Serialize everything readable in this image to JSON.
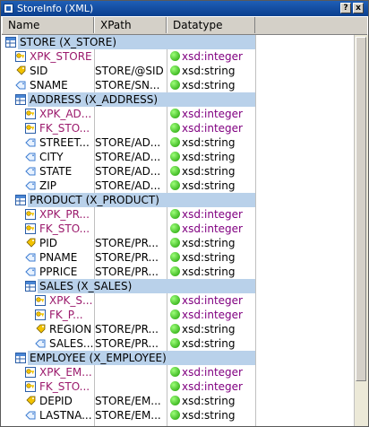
{
  "window": {
    "title": "StoreInfo (XML)",
    "help_label": "?",
    "close_label": "x"
  },
  "columns": {
    "name": "Name",
    "xpath": "XPath",
    "datatype": "Datatype"
  },
  "rows": [
    {
      "level": 0,
      "kind": "table",
      "name": "STORE     (X_STORE)",
      "xpath": "",
      "type": ""
    },
    {
      "level": 1,
      "kind": "key-pk",
      "name": "XPK_STORE",
      "xpath": "",
      "type": "xsd:integer",
      "red": true
    },
    {
      "level": 1,
      "kind": "key",
      "name": "SID",
      "xpath": "STORE/@SID",
      "type": "xsd:string"
    },
    {
      "level": 1,
      "kind": "attr",
      "name": "SNAME",
      "xpath": "STORE/SN...",
      "type": "xsd:string"
    },
    {
      "level": 1,
      "kind": "table",
      "name": "ADDRESS     (X_ADDRESS)",
      "xpath": "",
      "type": ""
    },
    {
      "level": 2,
      "kind": "key-pk",
      "name": "XPK_AD...",
      "xpath": "",
      "type": "xsd:integer",
      "red": true
    },
    {
      "level": 2,
      "kind": "key-fk",
      "name": "FK_STO...",
      "xpath": "",
      "type": "xsd:integer",
      "red": true
    },
    {
      "level": 2,
      "kind": "attr",
      "name": "STREET...",
      "xpath": "STORE/AD...",
      "type": "xsd:string"
    },
    {
      "level": 2,
      "kind": "attr",
      "name": "CITY",
      "xpath": "STORE/AD...",
      "type": "xsd:string"
    },
    {
      "level": 2,
      "kind": "attr",
      "name": "STATE",
      "xpath": "STORE/AD...",
      "type": "xsd:string"
    },
    {
      "level": 2,
      "kind": "attr",
      "name": "ZIP",
      "xpath": "STORE/AD...",
      "type": "xsd:string"
    },
    {
      "level": 1,
      "kind": "table",
      "name": "PRODUCT     (X_PRODUCT)",
      "xpath": "",
      "type": ""
    },
    {
      "level": 2,
      "kind": "key-pk",
      "name": "XPK_PR...",
      "xpath": "",
      "type": "xsd:integer",
      "red": true
    },
    {
      "level": 2,
      "kind": "key-fk",
      "name": "FK_STO...",
      "xpath": "",
      "type": "xsd:integer",
      "red": true
    },
    {
      "level": 2,
      "kind": "key",
      "name": "PID",
      "xpath": "STORE/PR...",
      "type": "xsd:string"
    },
    {
      "level": 2,
      "kind": "attr",
      "name": "PNAME",
      "xpath": "STORE/PR...",
      "type": "xsd:string"
    },
    {
      "level": 2,
      "kind": "attr",
      "name": "PPRICE",
      "xpath": "STORE/PR...",
      "type": "xsd:string"
    },
    {
      "level": 2,
      "kind": "table",
      "name": "SALES     (X_SALES)",
      "xpath": "",
      "type": ""
    },
    {
      "level": 3,
      "kind": "key-pk",
      "name": "XPK_S...",
      "xpath": "",
      "type": "xsd:integer",
      "red": true
    },
    {
      "level": 3,
      "kind": "key-fk",
      "name": "FK_P...",
      "xpath": "",
      "type": "xsd:integer",
      "red": true
    },
    {
      "level": 3,
      "kind": "key",
      "name": "REGION",
      "xpath": "STORE/PR...",
      "type": "xsd:string"
    },
    {
      "level": 3,
      "kind": "attr",
      "name": "SALES...",
      "xpath": "STORE/PR...",
      "type": "xsd:string"
    },
    {
      "level": 1,
      "kind": "table",
      "name": "EMPLOYEE     (X_EMPLOYEE)",
      "xpath": "",
      "type": ""
    },
    {
      "level": 2,
      "kind": "key-pk",
      "name": "XPK_EM...",
      "xpath": "",
      "type": "xsd:integer",
      "red": true
    },
    {
      "level": 2,
      "kind": "key-fk",
      "name": "FK_STO...",
      "xpath": "",
      "type": "xsd:integer",
      "red": true
    },
    {
      "level": 2,
      "kind": "key",
      "name": "DEPID",
      "xpath": "STORE/EM...",
      "type": "xsd:string"
    },
    {
      "level": 2,
      "kind": "attr",
      "name": "LASTNA...",
      "xpath": "STORE/EM...",
      "type": "xsd:string"
    }
  ],
  "colors": {
    "selection": "#b9d1ea",
    "key_text": "#9b1a6c",
    "integer_text": "#800080",
    "status_dot": "#1a9c00"
  }
}
